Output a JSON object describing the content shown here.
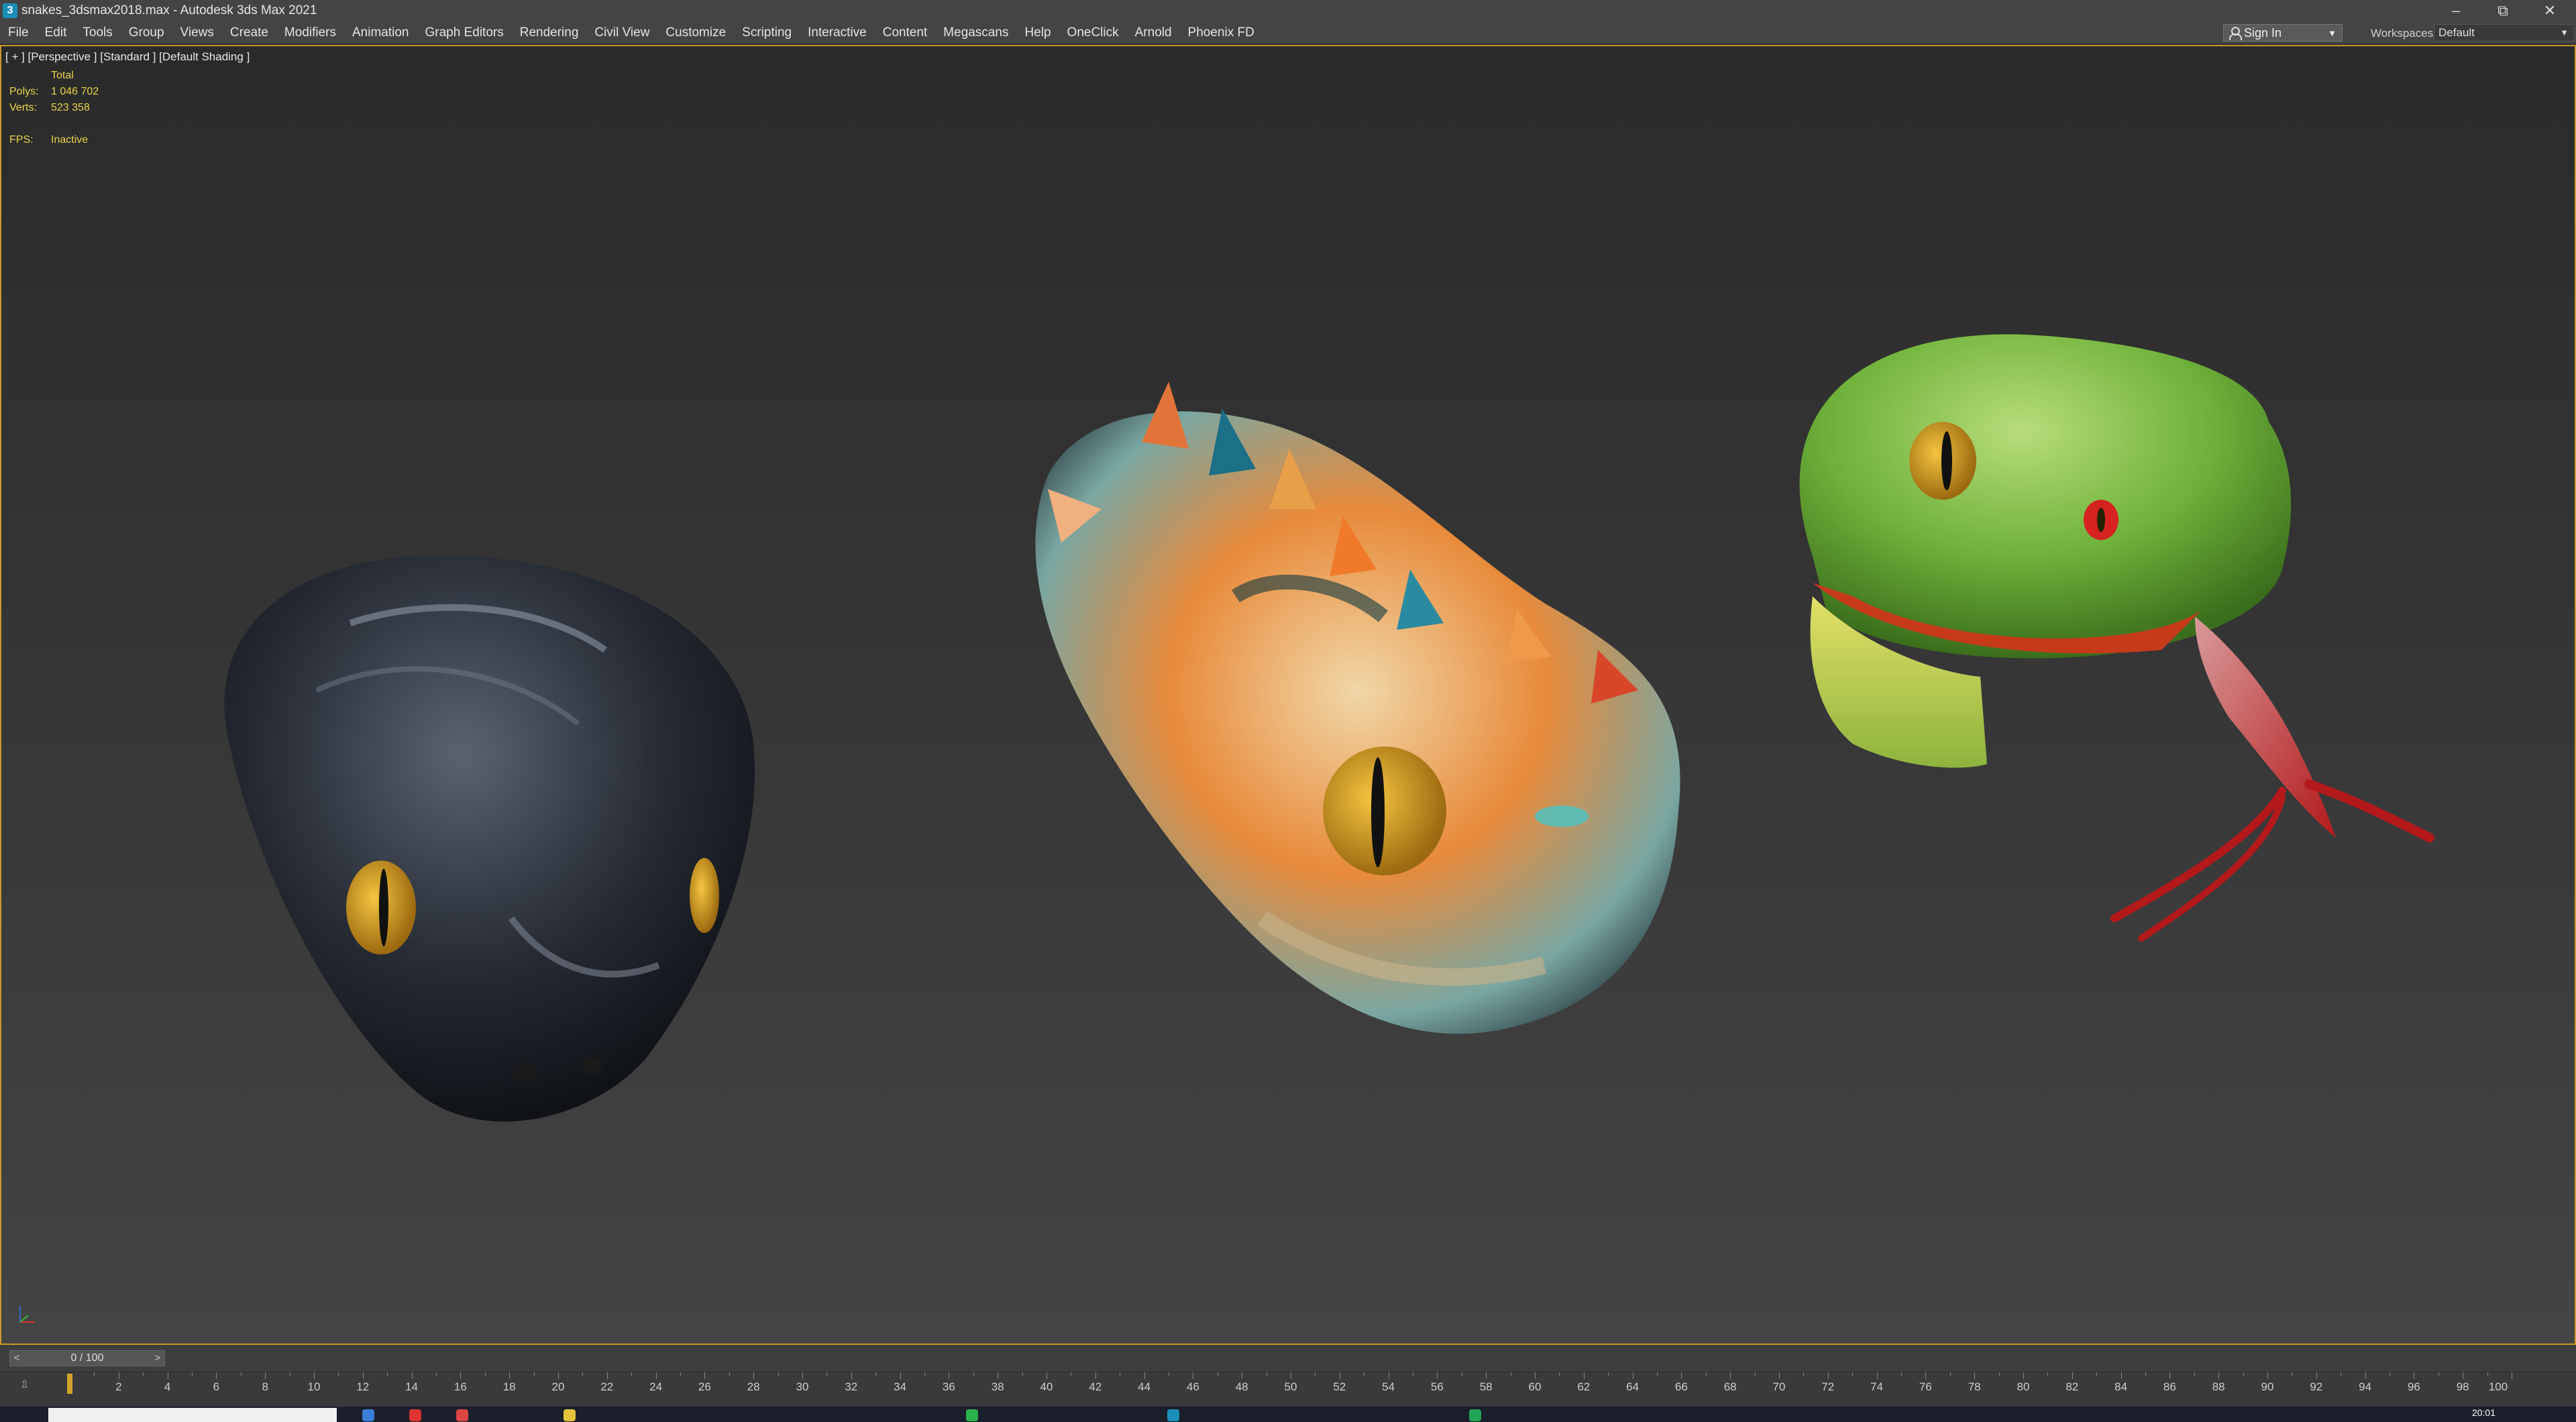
{
  "window": {
    "title": "snakes_3dsmax2018.max - Autodesk 3ds Max 2021",
    "app_icon": "3",
    "controls": [
      "minimize-icon",
      "restore-icon",
      "close-icon"
    ]
  },
  "menu": {
    "items": [
      "File",
      "Edit",
      "Tools",
      "Group",
      "Views",
      "Create",
      "Modifiers",
      "Animation",
      "Graph Editors",
      "Rendering",
      "Civil View",
      "Customize",
      "Scripting",
      "Interactive",
      "Content",
      "Megascans",
      "Help",
      "OneClick",
      "Arnold",
      "Phoenix FD"
    ],
    "sign_in": "Sign In",
    "workspaces_label": "Workspaces:",
    "workspaces_value": "Default"
  },
  "viewport": {
    "label": "[ + ] [Perspective ] [Standard ] [Default Shading ]",
    "stats": {
      "total_label": "Total",
      "polys_label": "Polys:",
      "polys_value": "1 046 702",
      "verts_label": "Verts:",
      "verts_value": "523 358",
      "fps_label": "FPS:",
      "fps_value": "Inactive"
    },
    "accent_color": "#c89b2a",
    "stats_color": "#e9d34a"
  },
  "timeline": {
    "slider_value": "0 / 100",
    "prev": "<",
    "next": ">",
    "ruler_labels": [
      "2",
      "4",
      "6",
      "8",
      "10",
      "12",
      "14",
      "16",
      "18",
      "20",
      "22",
      "24",
      "26",
      "28",
      "30",
      "32",
      "34",
      "36",
      "38",
      "40",
      "42",
      "44",
      "46",
      "48",
      "50",
      "52",
      "54",
      "56",
      "58",
      "60",
      "62",
      "64",
      "66",
      "68",
      "70",
      "72",
      "74",
      "76",
      "78",
      "80",
      "82",
      "84",
      "86",
      "88",
      "90",
      "92",
      "94",
      "96",
      "98",
      "100"
    ]
  },
  "taskbar": {
    "clock": "20:01"
  }
}
